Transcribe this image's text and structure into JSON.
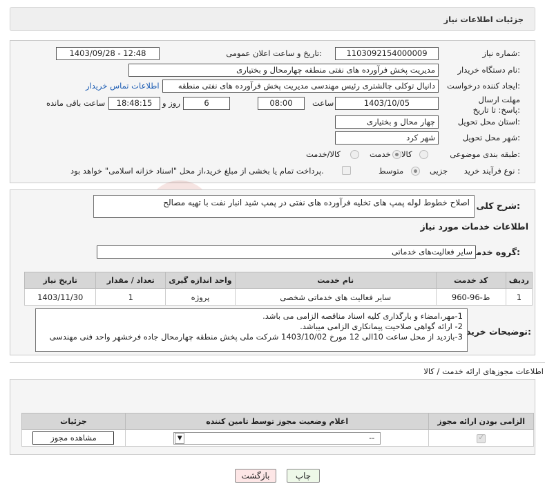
{
  "header": {
    "title": "جزئیات اطلاعات نیاز"
  },
  "form": {
    "need_number_label": "شماره نیاز:",
    "need_number": "1103092154000009",
    "announce_label": "تاریخ و ساعت اعلان عمومی:",
    "announce_value": "1403/09/28 - 12:48",
    "buyer_label": "نام دستگاه خریدار:",
    "buyer_value": "مدیریت پخش فرآورده های نفتی منطقه چهارمحال و بختیاری",
    "creator_label": "ایجاد کننده درخواست:",
    "creator_value": "دانیال توکلی چالشتری رئیس مهندسی مدیریت پخش فرآورده های نفتی منطقه",
    "contact_link": "اطلاعات تماس خریدار",
    "deadline_label": "مهلت ارسال پاسخ: تا تاریخ:",
    "deadline_date": "1403/10/05",
    "time_label": "ساعت",
    "deadline_time": "08:00",
    "days_value": "6",
    "days_label": "روز و",
    "remaining_time": "18:48:15",
    "remaining_label": "ساعت باقی مانده",
    "province_label": "استان محل تحویل:",
    "province_value": "چهار محال و بختیاری",
    "city_label": "شهر محل تحویل:",
    "city_value": "شهر کرد",
    "category_label": "طبقه بندی موضوعی:",
    "category_options": [
      "کالا",
      "خدمت",
      "کالا/خدمت"
    ],
    "category_selected": "خدمت",
    "process_label": "نوع فرآیند خرید :",
    "process_options": [
      "جزیی",
      "متوسط"
    ],
    "process_selected": "جزیی",
    "payment_note": "پرداخت تمام یا بخشی از مبلغ خرید،از محل \"اسناد خزانه اسلامی\" خواهد بود."
  },
  "description": {
    "label": "شرح کلی نیاز:",
    "value": "اصلاح خطوط لوله پمپ های تخلیه فرآورده های نفتی در پمپ شید انبار نفت با تهیه مصالح"
  },
  "services": {
    "section_title": "اطلاعات خدمات مورد نیاز",
    "group_label": "گروه خدمت:",
    "group_value": "سایر فعالیت‌های خدماتی",
    "columns": [
      "ردیف",
      "کد خدمت",
      "نام خدمت",
      "واحد اندازه گیری",
      "تعداد / مقدار",
      "تاریخ نیاز"
    ],
    "rows": [
      {
        "row": "1",
        "code": "ط-96-960",
        "name": "سایر فعالیت های خدماتی شخصی",
        "unit": "پروژه",
        "qty": "1",
        "date": "1403/11/30"
      }
    ]
  },
  "buyer_notes": {
    "label": "توضیحات خریدار:",
    "lines": [
      "1-مهر،امضاء و بارگذاری کلیه اسناد مناقصه الزامی می باشد.",
      "2- ارائه گواهی صلاحیت پیمانکاری الزامی میباشد.",
      "3-بازدید از محل ساعت 10الی 12 مورخ 1403/10/02 شرکت ملی پخش منطقه چهارمحال جاده فرخشهر واحد فنی مهندسی"
    ]
  },
  "permits": {
    "section_title": "اطلاعات مجوزهای ارائه خدمت / کالا",
    "columns": [
      "الزامی بودن ارائه مجوز",
      "اعلام وضعیت مجوز توسط تامین کننده",
      "جزئیات"
    ],
    "select_value": "--",
    "view_button": "مشاهده مجوز"
  },
  "actions": {
    "print": "چاپ",
    "back": "بازگشت"
  },
  "watermark": {
    "text": "AriaTender.neT"
  },
  "colors": {
    "link": "#1a5bb3",
    "header_bg": "#efefef",
    "table_header": "#d6d6d6",
    "back_button": "#fde6e6",
    "print_button": "#eef8e8"
  }
}
